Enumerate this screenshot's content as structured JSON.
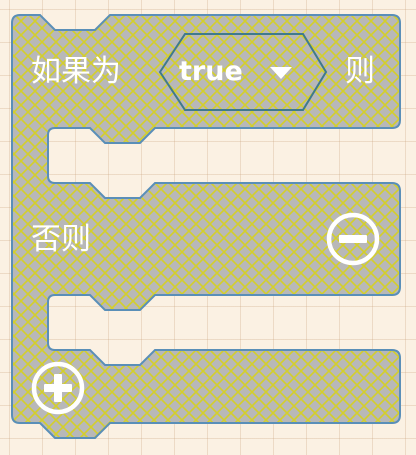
{
  "block": {
    "type": "if-else",
    "if_label": "如果为",
    "then_label": "则",
    "else_label": "否则",
    "condition": {
      "value": "true"
    },
    "remove_icon": "minus-circle-icon",
    "add_icon": "plus-circle-icon"
  },
  "colors": {
    "workspace_background": "#fbf1e3",
    "block_fill": "#b8b8b8",
    "block_pattern": "#d4cf2a",
    "block_outline": "#5a8fb8",
    "text": "#ffffff"
  }
}
